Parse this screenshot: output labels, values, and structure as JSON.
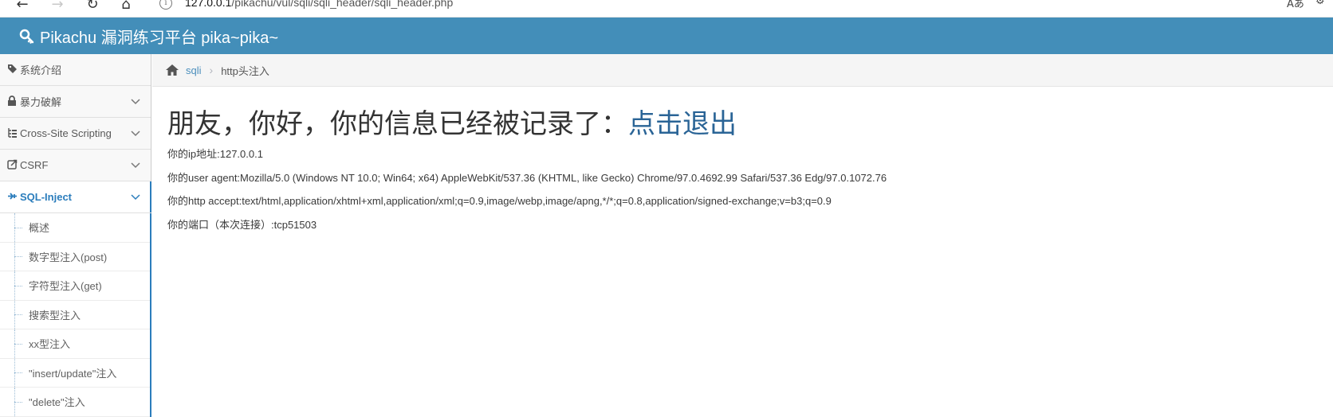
{
  "browser": {
    "url_host": "127.0.0.1",
    "url_path": "/pikachu/vul/sqli/sqli_header/sqli_header.php"
  },
  "header": {
    "title": "Pikachu 漏洞练习平台 pika~pika~"
  },
  "sidebar": {
    "items": [
      {
        "label": "系统介绍",
        "icon": "tag-icon"
      },
      {
        "label": "暴力破解",
        "icon": "lock-icon"
      },
      {
        "label": "Cross-Site Scripting",
        "icon": "list-icon"
      },
      {
        "label": "CSRF",
        "icon": "share-icon"
      },
      {
        "label": "SQL-Inject",
        "icon": "bolt-icon"
      }
    ],
    "subitems": [
      "概述",
      "数字型注入(post)",
      "字符型注入(get)",
      "搜索型注入",
      "xx型注入",
      "\"insert/update\"注入",
      "\"delete\"注入"
    ]
  },
  "breadcrumb": {
    "home_label": "sqli",
    "current": "http头注入"
  },
  "main": {
    "headline": "朋友，你好，你的信息已经被记录了：",
    "logout_link": "点击退出",
    "lines": [
      "你的ip地址:127.0.0.1",
      "你的user agent:Mozilla/5.0 (Windows NT 10.0; Win64; x64) AppleWebKit/537.36 (KHTML, like Gecko) Chrome/97.0.4692.99 Safari/537.36 Edg/97.0.1072.76",
      "你的http accept:text/html,application/xhtml+xml,application/xml;q=0.9,image/webp,image/apng,*/*;q=0.8,application/signed-exchange;v=b3;q=0.9",
      "你的端口（本次连接）:tcp51503"
    ]
  },
  "colors": {
    "header_bg": "#438eb9",
    "link": "#2a6496",
    "active_menu": "#2b7dbc"
  }
}
